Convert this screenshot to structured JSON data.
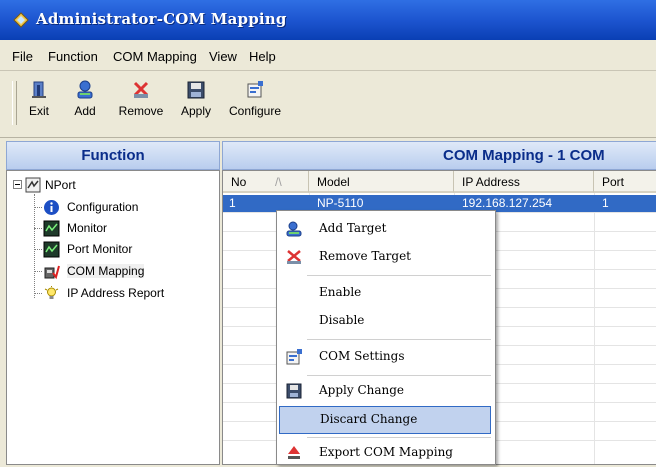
{
  "window": {
    "title": "Administrator-COM Mapping"
  },
  "menubar": {
    "items": [
      {
        "label": "File"
      },
      {
        "label": "Function"
      },
      {
        "label": "COM Mapping"
      },
      {
        "label": "View"
      },
      {
        "label": "Help"
      }
    ]
  },
  "toolbar": {
    "buttons": [
      {
        "label": "Exit",
        "icon": "exit-icon"
      },
      {
        "label": "Add",
        "icon": "add-icon"
      },
      {
        "label": "Remove",
        "icon": "remove-icon"
      },
      {
        "label": "Apply",
        "icon": "save-icon"
      },
      {
        "label": "Configure",
        "icon": "configure-icon"
      }
    ]
  },
  "function_panel": {
    "header": "Function",
    "root": "NPort",
    "items": [
      {
        "label": "Configuration",
        "icon": "info-icon"
      },
      {
        "label": "Monitor",
        "icon": "monitor-icon"
      },
      {
        "label": "Port Monitor",
        "icon": "monitor-icon"
      },
      {
        "label": "COM Mapping",
        "icon": "com-mapping-icon",
        "selected": true
      },
      {
        "label": "IP Address Report",
        "icon": "ip-report-icon"
      }
    ]
  },
  "mapping_panel": {
    "header": "COM Mapping - 1 COM",
    "columns": [
      "No",
      "Model",
      "IP Address",
      "Port"
    ],
    "rows": [
      {
        "no": "1",
        "model": "NP-5110",
        "ip": "192.168.127.254",
        "port": "1",
        "selected": true
      }
    ]
  },
  "context_menu": {
    "items": [
      {
        "label": "Add Target",
        "icon": "add-target-icon"
      },
      {
        "label": "Remove Target",
        "icon": "remove-target-icon"
      },
      {
        "label": "Enable"
      },
      {
        "label": "Disable"
      },
      {
        "label": "COM Settings",
        "icon": "com-settings-icon"
      },
      {
        "label": "Apply Change",
        "icon": "save-icon"
      },
      {
        "label": "Discard Change",
        "highlighted": true
      },
      {
        "label": "Export COM Mapping",
        "icon": "export-icon"
      }
    ]
  },
  "colors": {
    "title_bar": "#1d55d0",
    "selection": "#316ac5",
    "panel_header_text": "#0a2d8a",
    "menu_highlight": "#c1d2ee"
  }
}
